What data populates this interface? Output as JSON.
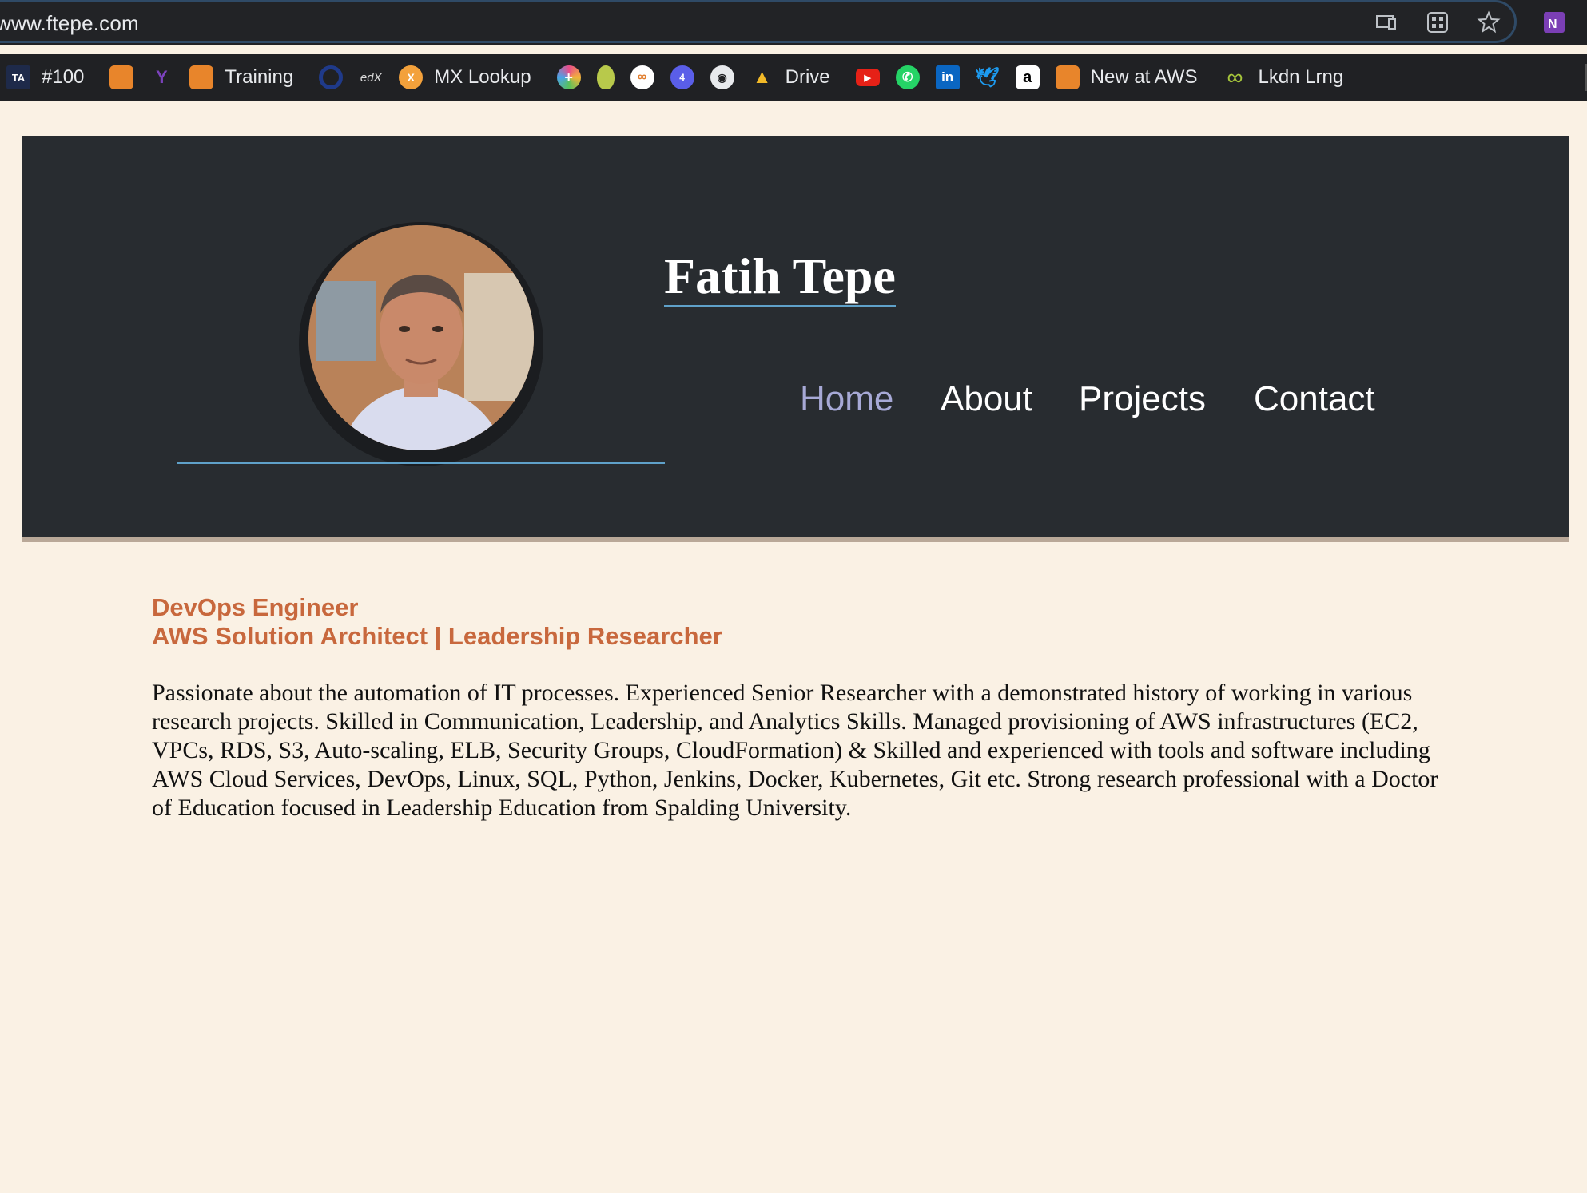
{
  "browser": {
    "url": "www.ftepe.com",
    "bookmarks": [
      {
        "icon": "ta-icon",
        "label": "#100"
      },
      {
        "icon": "aws-cube-icon",
        "label": ""
      },
      {
        "icon": "terraform-icon",
        "label": ""
      },
      {
        "icon": "aws-cube-icon",
        "label": "Training"
      },
      {
        "icon": "ring-icon",
        "label": ""
      },
      {
        "icon": "edx-icon",
        "label": ""
      },
      {
        "icon": "mx-icon",
        "label": "MX Lookup"
      },
      {
        "icon": "plus-circle-icon",
        "label": ""
      },
      {
        "icon": "pear-icon",
        "label": ""
      },
      {
        "icon": "infinity-circle-icon",
        "label": ""
      },
      {
        "icon": "notification-icon",
        "label": ""
      },
      {
        "icon": "github-icon",
        "label": ""
      },
      {
        "icon": "google-drive-icon",
        "label": "Drive"
      },
      {
        "icon": "youtube-icon",
        "label": ""
      },
      {
        "icon": "whatsapp-icon",
        "label": ""
      },
      {
        "icon": "linkedin-icon",
        "label": ""
      },
      {
        "icon": "twitter-icon",
        "label": ""
      },
      {
        "icon": "amazon-icon",
        "label": ""
      },
      {
        "icon": "aws-cube-icon",
        "label": "New at AWS"
      },
      {
        "icon": "infinity-icon",
        "label": "Lkdn Lrng"
      }
    ]
  },
  "site": {
    "name": "Fatih Tepe",
    "nav": [
      "Home",
      "About",
      "Projects",
      "Contact"
    ],
    "role_line1": "DevOps Engineer",
    "role_line2": "AWS Solution Architect | Leadership Researcher",
    "bio": "Passionate about the automation of IT processes. Experienced Senior Researcher with a demonstrated history of working in various research projects. Skilled in Communication, Leadership, and Analytics Skills. Managed provisioning of AWS infrastructures (EC2, VPCs, RDS, S3, Auto-scaling, ELB, Security Groups, CloudFormation) & Skilled and experienced with tools and software including AWS Cloud Services, DevOps, Linux, SQL, Python, Jenkins, Docker, Kubernetes, Git etc. Strong research professional with a Doctor of Education focused in Leadership Education from Spalding University."
  },
  "colors": {
    "background": "#faf1e4",
    "hero": "#282c30",
    "accent_orange": "#c8683d",
    "nav_active": "#a7a9d6",
    "underline": "#5fa1c9"
  }
}
